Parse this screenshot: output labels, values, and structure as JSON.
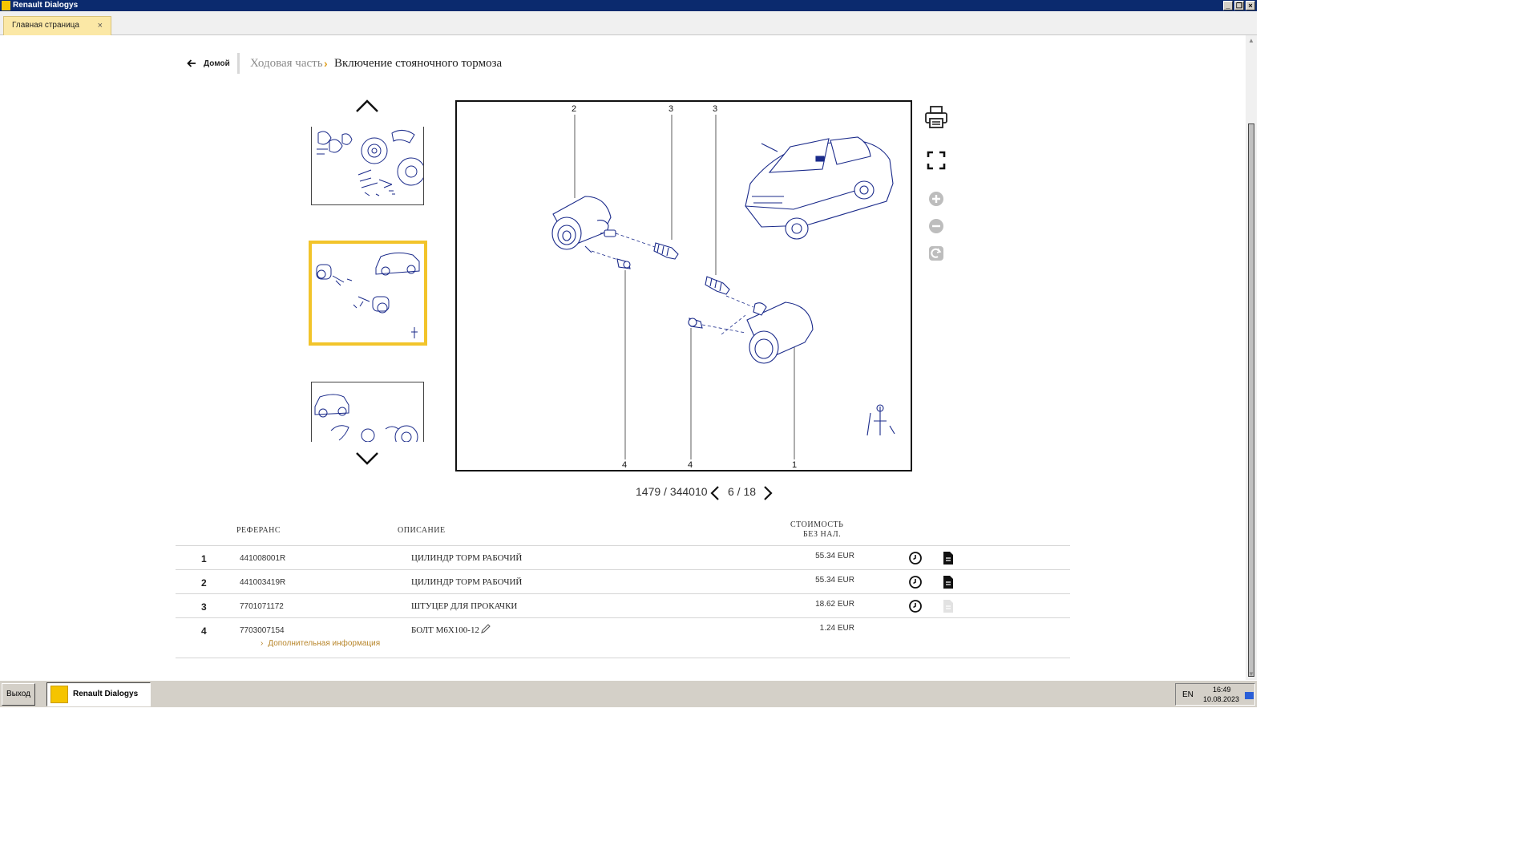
{
  "window": {
    "title": "Renault Dialogys"
  },
  "tabs": [
    {
      "label": "Главная страница",
      "close": "×"
    }
  ],
  "breadcrumb": {
    "home": "Домой",
    "parent": "Ходовая часть",
    "separator": "›",
    "current": "Включение стояночного тормоза"
  },
  "diagram": {
    "callouts": [
      "2",
      "3",
      "3",
      "4",
      "4",
      "1"
    ]
  },
  "pager": {
    "reference": "1479 / 344010",
    "page": "6 / 18"
  },
  "table": {
    "headers": {
      "reference": "РЕФЕРАНС",
      "description": "ОПИСАНИЕ",
      "price_line1": "СТОИМОСТЬ",
      "price_line2": "БЕЗ НАЛ."
    },
    "rows": [
      {
        "num": "1",
        "ref": "441008001R",
        "desc": "ЦИЛИНДР ТОРМ РАБОЧИЙ",
        "price": "55.34 EUR"
      },
      {
        "num": "2",
        "ref": "441003419R",
        "desc": "ЦИЛИНДР ТОРМ РАБОЧИЙ",
        "price": "55.34 EUR"
      },
      {
        "num": "3",
        "ref": "7701071172",
        "desc": "ШТУЦЕР ДЛЯ ПРОКАЧКИ",
        "price": "18.62 EUR"
      },
      {
        "num": "4",
        "ref": "7703007154",
        "desc": "БОЛТ M6X100-12",
        "price": "1.24 EUR",
        "more": "Дополнительная информация"
      }
    ]
  },
  "taskbar": {
    "exit": "Выход",
    "app": "Renault Dialogys",
    "lang": "EN",
    "time": "16:49",
    "date": "10.08.2023"
  },
  "colors": {
    "accent": "#f2c42b",
    "titlebar": "#0b2a6e",
    "link": "#b8862b",
    "diagram_line": "#1a2a8a"
  }
}
